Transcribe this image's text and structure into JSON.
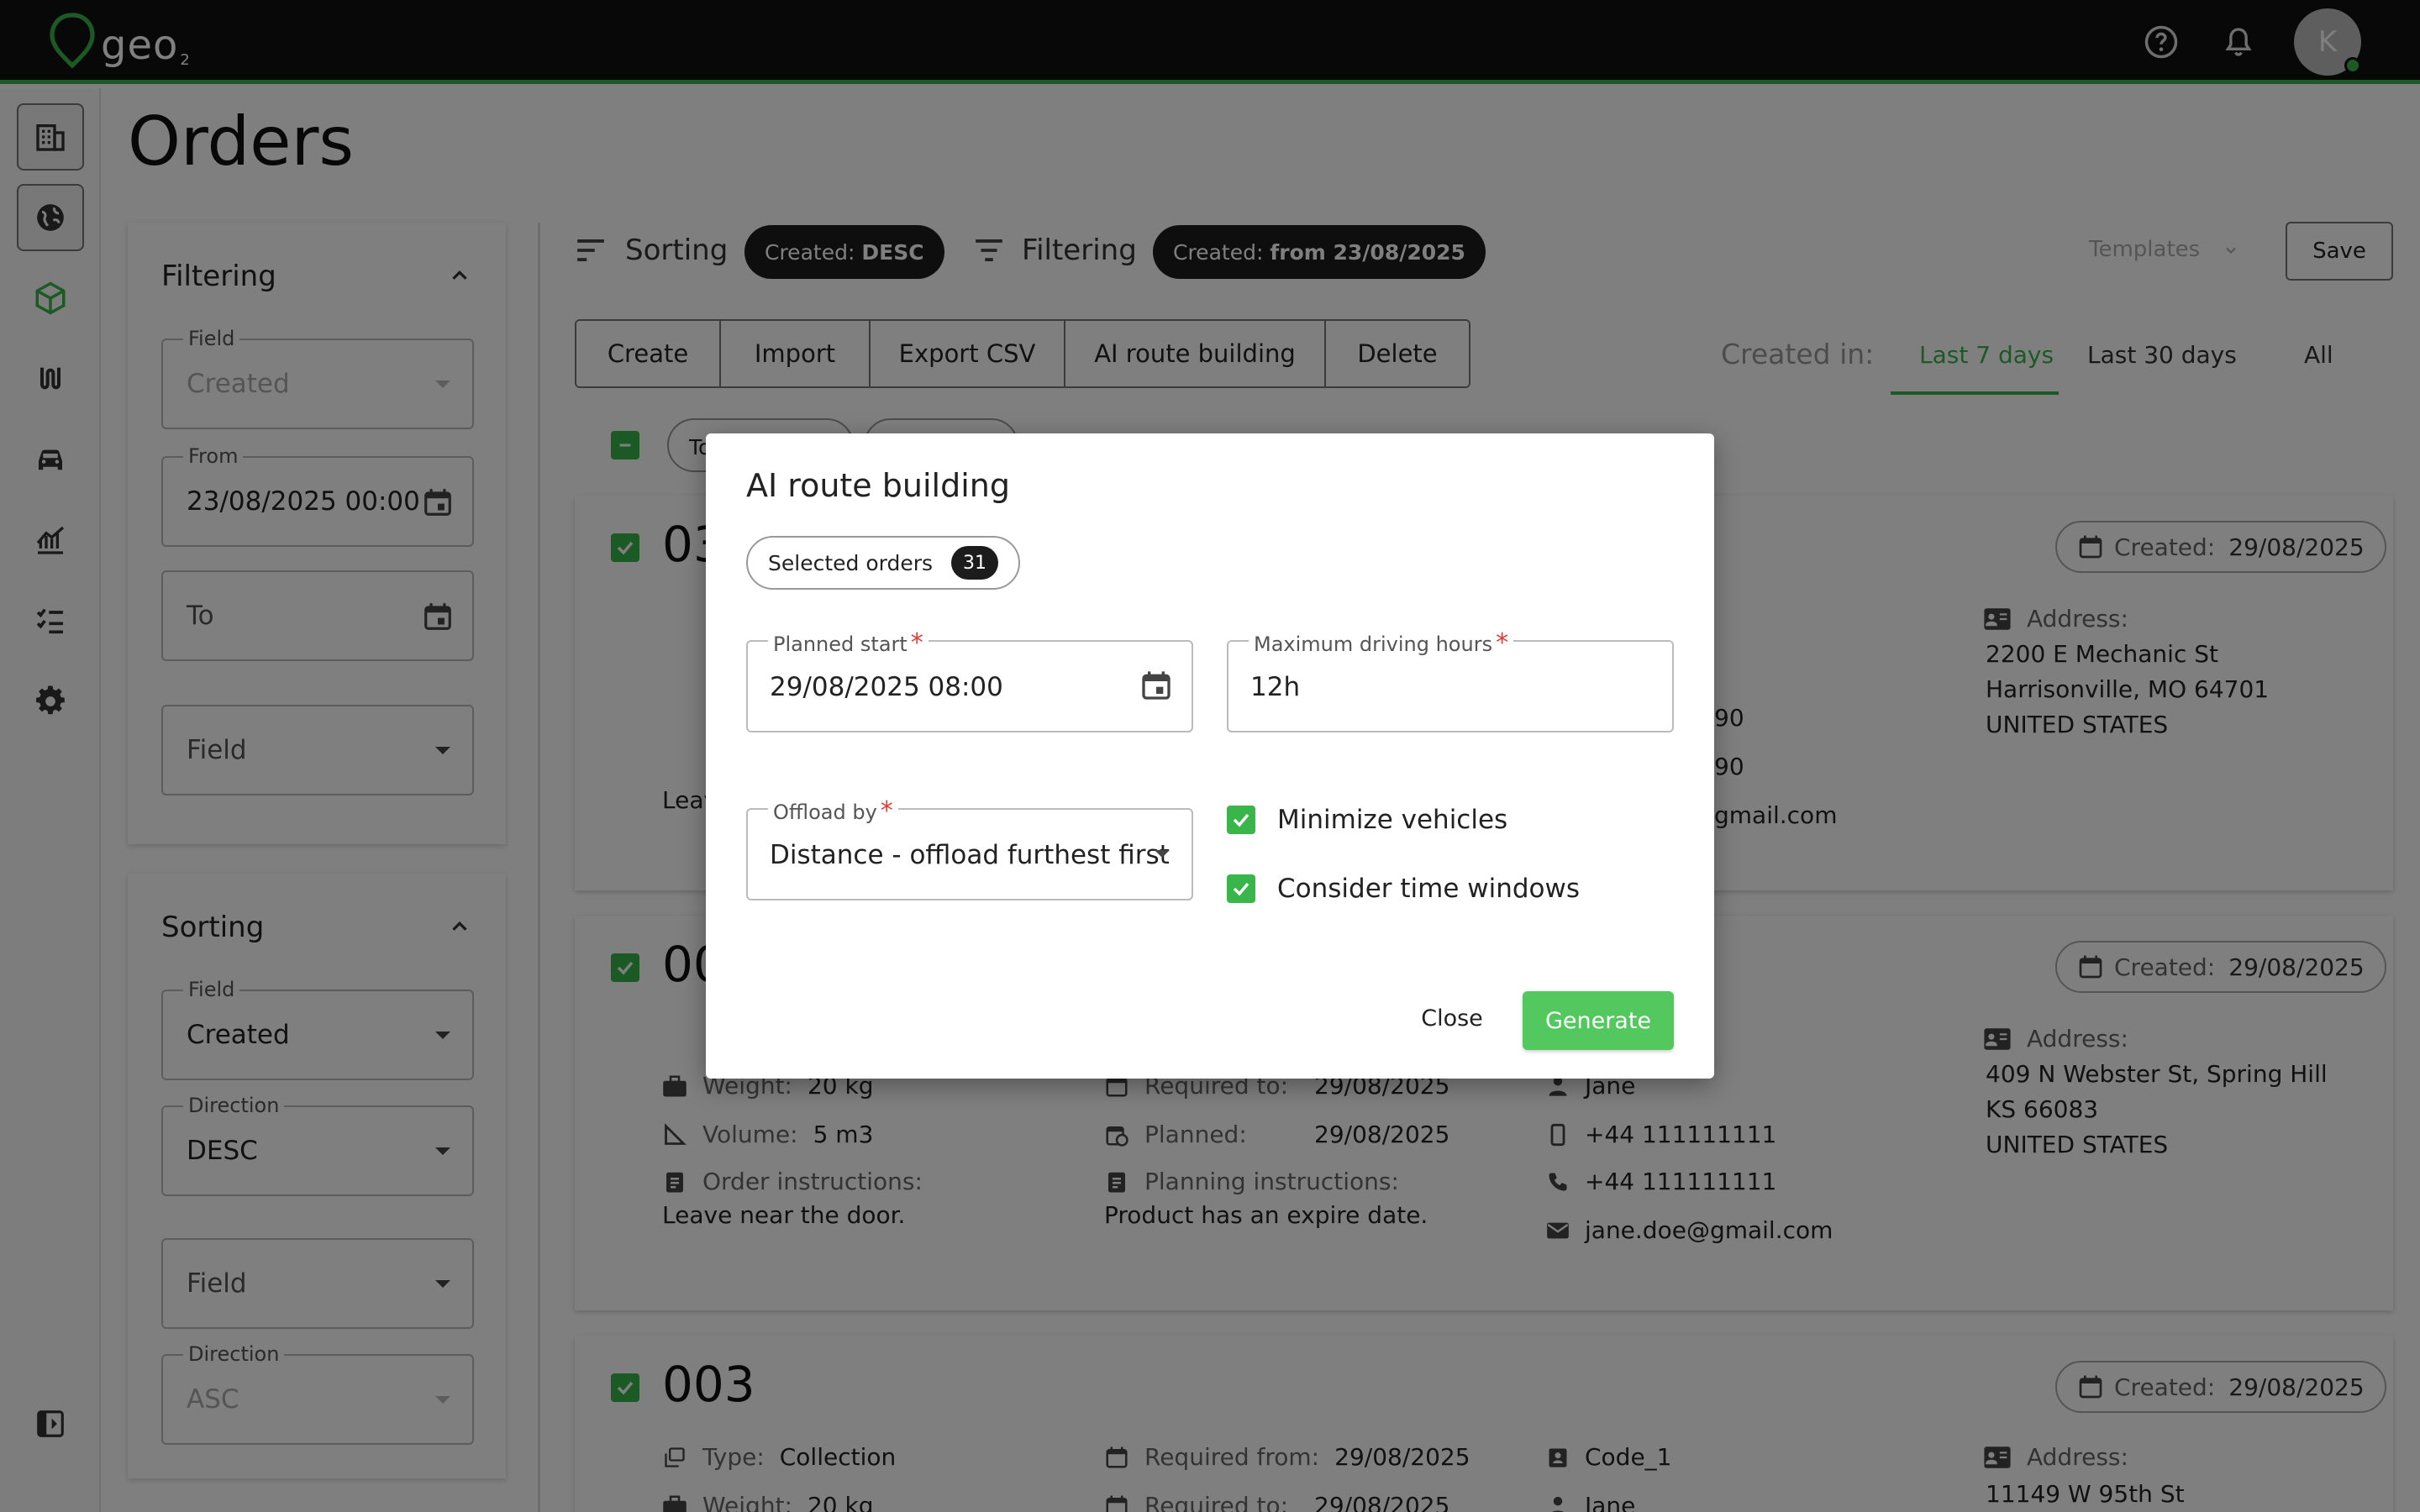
{
  "app": {
    "logo_text": "geo",
    "logo_sub": "2",
    "avatar_initial": "K"
  },
  "colors": {
    "brand": "#39b54a",
    "topbar": "#111111",
    "chip_dark": "#1c1c1c"
  },
  "nav": {
    "icons": [
      "building-icon",
      "globe-icon",
      "cube-icon",
      "route-icon",
      "car-icon",
      "chart-icon",
      "checklist-icon",
      "gear-icon",
      "collapse-icon"
    ]
  },
  "page": {
    "title": "Orders"
  },
  "filter_panel": {
    "title": "Filtering",
    "field_label": "Field",
    "field_value": "Created",
    "from_label": "From",
    "from_value": "23/08/2025 00:00",
    "to_placeholder": "To",
    "field2_placeholder": "Field"
  },
  "sort_panel": {
    "title": "Sorting",
    "field_label": "Field",
    "field_value": "Created",
    "direction_label": "Direction",
    "direction_value": "DESC",
    "field2_placeholder": "Field",
    "direction2_label": "Direction",
    "direction2_value": "ASC"
  },
  "toolbar": {
    "sorting_label": "Sorting",
    "sorting_chip_prefix": "Created:",
    "sorting_chip_value": "DESC",
    "filtering_label": "Filtering",
    "filtering_chip_prefix": "Created:",
    "filtering_chip_value": "from 23/08/2025",
    "templates_label": "Templates",
    "save_label": "Save"
  },
  "actions": {
    "create": "Create",
    "import": "Import",
    "export": "Export CSV",
    "ai": "AI route building",
    "delete": "Delete"
  },
  "created_in": {
    "label": "Created in:",
    "tabs": [
      "Last 7 days",
      "Last 30 days",
      "All"
    ],
    "active": "Last 7 days"
  },
  "partial_chips": {
    "left": "To"
  },
  "orders": [
    {
      "num": "03",
      "created_label": "Created:",
      "created": "29/08/2025",
      "address_label": "Address:",
      "address": [
        "2200 E Mechanic St",
        "Harrisonville, MO 64701",
        "UNITED STATES"
      ],
      "partial": {
        "text": "Leav",
        "phone1": "90",
        "phone2": "90",
        "email": "gmail.com"
      }
    },
    {
      "num": "00",
      "created_label": "Created:",
      "created": "29/08/2025",
      "weight_label": "Weight:",
      "weight": "20 kg",
      "volume_label": "Volume:",
      "volume": "5 m3",
      "instr_label": "Order instructions:",
      "instr": "Leave near the door.",
      "req_to_label": "Required to:",
      "req_to": "29/08/2025",
      "planned_label": "Planned:",
      "planned": "29/08/2025",
      "plan_instr_label": "Planning instructions:",
      "plan_instr": "Product has an expire date.",
      "contact": "Jane",
      "mobile": "+44 111111111",
      "phone": "+44 111111111",
      "email": "jane.doe@gmail.com",
      "address_label": "Address:",
      "address": [
        "409 N Webster St, Spring Hill",
        "KS 66083",
        "UNITED STATES"
      ]
    },
    {
      "num": "003",
      "created_label": "Created:",
      "created": "29/08/2025",
      "type_label": "Type:",
      "type": "Collection",
      "req_from_label": "Required from:",
      "req_from": "29/08/2025",
      "code": "Code_1",
      "weight_label": "Weight:",
      "weight": "20 kg",
      "req_to_label": "Required to:",
      "req_to": "29/08/2025",
      "contact": "Jane",
      "address_label": "Address:",
      "address": [
        "11149 W 95th St"
      ]
    }
  ],
  "modal": {
    "title": "AI route building",
    "selected_label": "Selected orders",
    "selected_count": "31",
    "planned_start_label": "Planned start",
    "planned_start_value": "29/08/2025 08:00",
    "max_hours_label": "Maximum driving hours",
    "max_hours_value": "12h",
    "offload_label": "Offload by",
    "offload_value": "Distance - offload furthest first",
    "minimize_vehicles": "Minimize vehicles",
    "minimize_vehicles_checked": true,
    "time_windows": "Consider time windows",
    "time_windows_checked": true,
    "required_mark": "*",
    "close_label": "Close",
    "generate_label": "Generate"
  }
}
